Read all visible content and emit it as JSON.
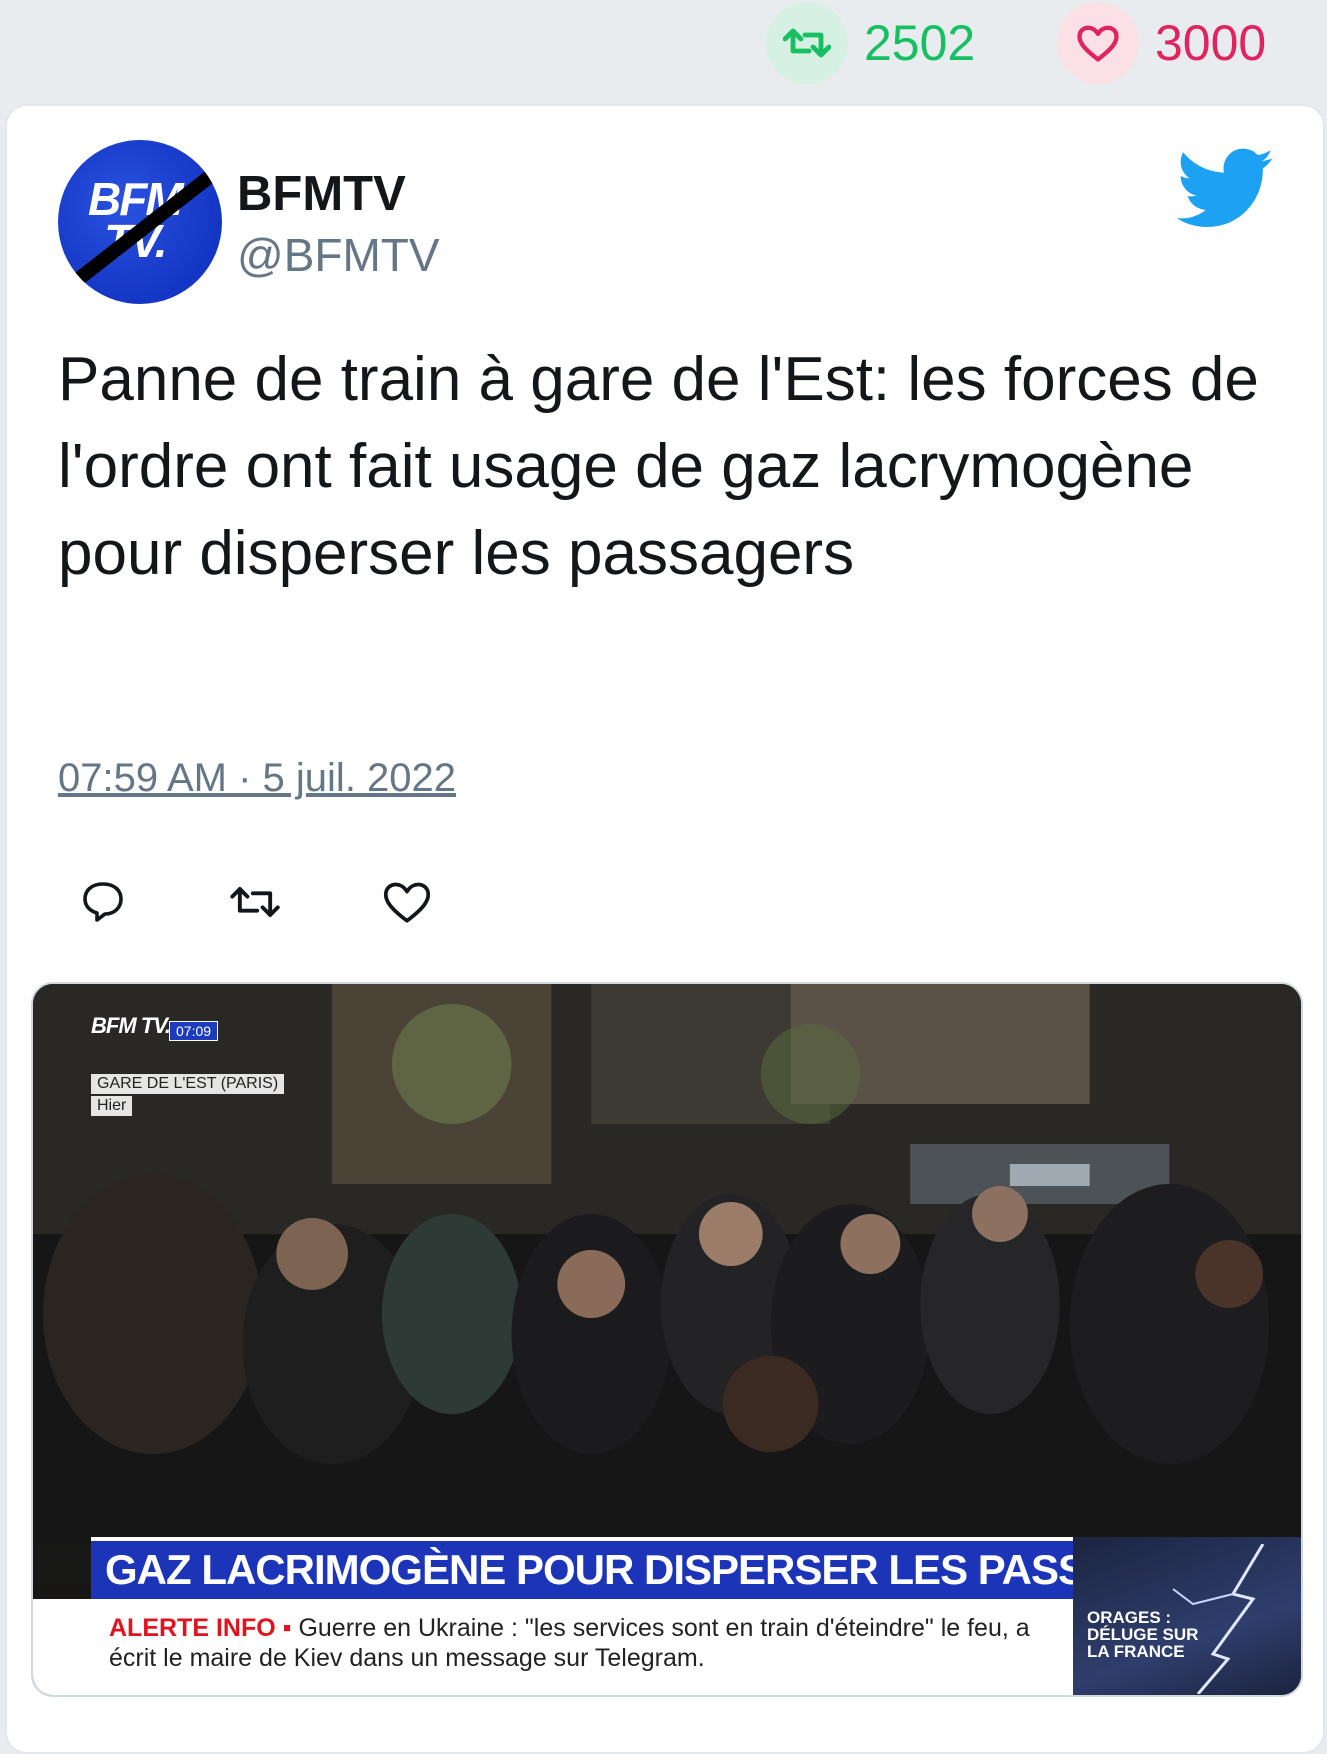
{
  "stats": {
    "retweets": "2502",
    "likes": "3000"
  },
  "tweet": {
    "author_name": "BFMTV",
    "author_handle": "@BFMTV",
    "avatar_text": "BFM TV.",
    "text": "Panne de train à gare de l'Est: les forces de l'ordre ont fait usage de gaz lacrymogène pour disperser les passagers",
    "timestamp": "07:59 AM · 5 juil. 2022"
  },
  "media": {
    "channel_logo": "BFM TV.",
    "time_chip": "07:09",
    "location": "GARE DE L'EST (PARIS)",
    "location_sub": "Hier",
    "headline": "GAZ LACRIMOGÈNE POUR DISPERSER LES PASSAGERS",
    "alert_label": "ALERTE INFO",
    "alert_text": "Guerre en Ukraine : \"les services sont en train d'éteindre\" le feu, a écrit le maire de Kiev dans un message sur Telegram.",
    "side_label_1": "ORAGES :",
    "side_label_2": "DÉLUGE SUR",
    "side_label_3": "LA FRANCE"
  },
  "colors": {
    "retweet_green": "#17bf63",
    "like_red": "#e0245e",
    "twitter_blue": "#1da1f2",
    "bfm_blue": "#1c35b8"
  },
  "icons": [
    "retweet-icon",
    "heart-icon",
    "twitter-bird-icon",
    "reply-icon"
  ]
}
